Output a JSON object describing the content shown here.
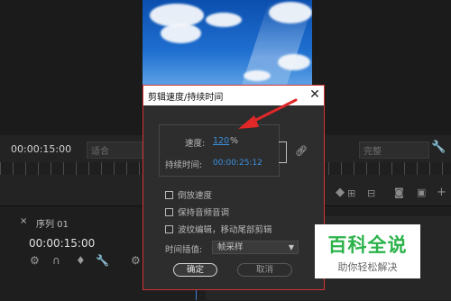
{
  "editor": {
    "program_timecode": "00:00:15:00",
    "fit_label": "适合",
    "full_label": "完整",
    "sequence_tab": "序列 01",
    "timeline_timecode": "00:00:15:00",
    "timeline_close": "×"
  },
  "dialog": {
    "title": "剪辑速度/持续时间",
    "close_glyph": "✕",
    "speed_label": "速度:",
    "speed_value": "120",
    "speed_unit": "%",
    "duration_label": "持续时间:",
    "duration_value": "00:00:25:12",
    "link_icon": "chain-link-icon",
    "checkboxes": [
      {
        "label": "倒放速度",
        "checked": false
      },
      {
        "label": "保持音频音调",
        "checked": false
      },
      {
        "label": "波纹编辑，移动尾部剪辑",
        "checked": false
      }
    ],
    "interpolation_label": "时间插值:",
    "interpolation_value": "帧采样",
    "ok_label": "确定",
    "cancel_label": "取消"
  },
  "watermark": {
    "main": "百科全说",
    "sub": "助你轻松解决",
    "color": "#2bb34a"
  },
  "colors": {
    "accent_blue": "#3b8fe0",
    "annotation_red": "#e02828",
    "dialog_border": "#d03434"
  }
}
